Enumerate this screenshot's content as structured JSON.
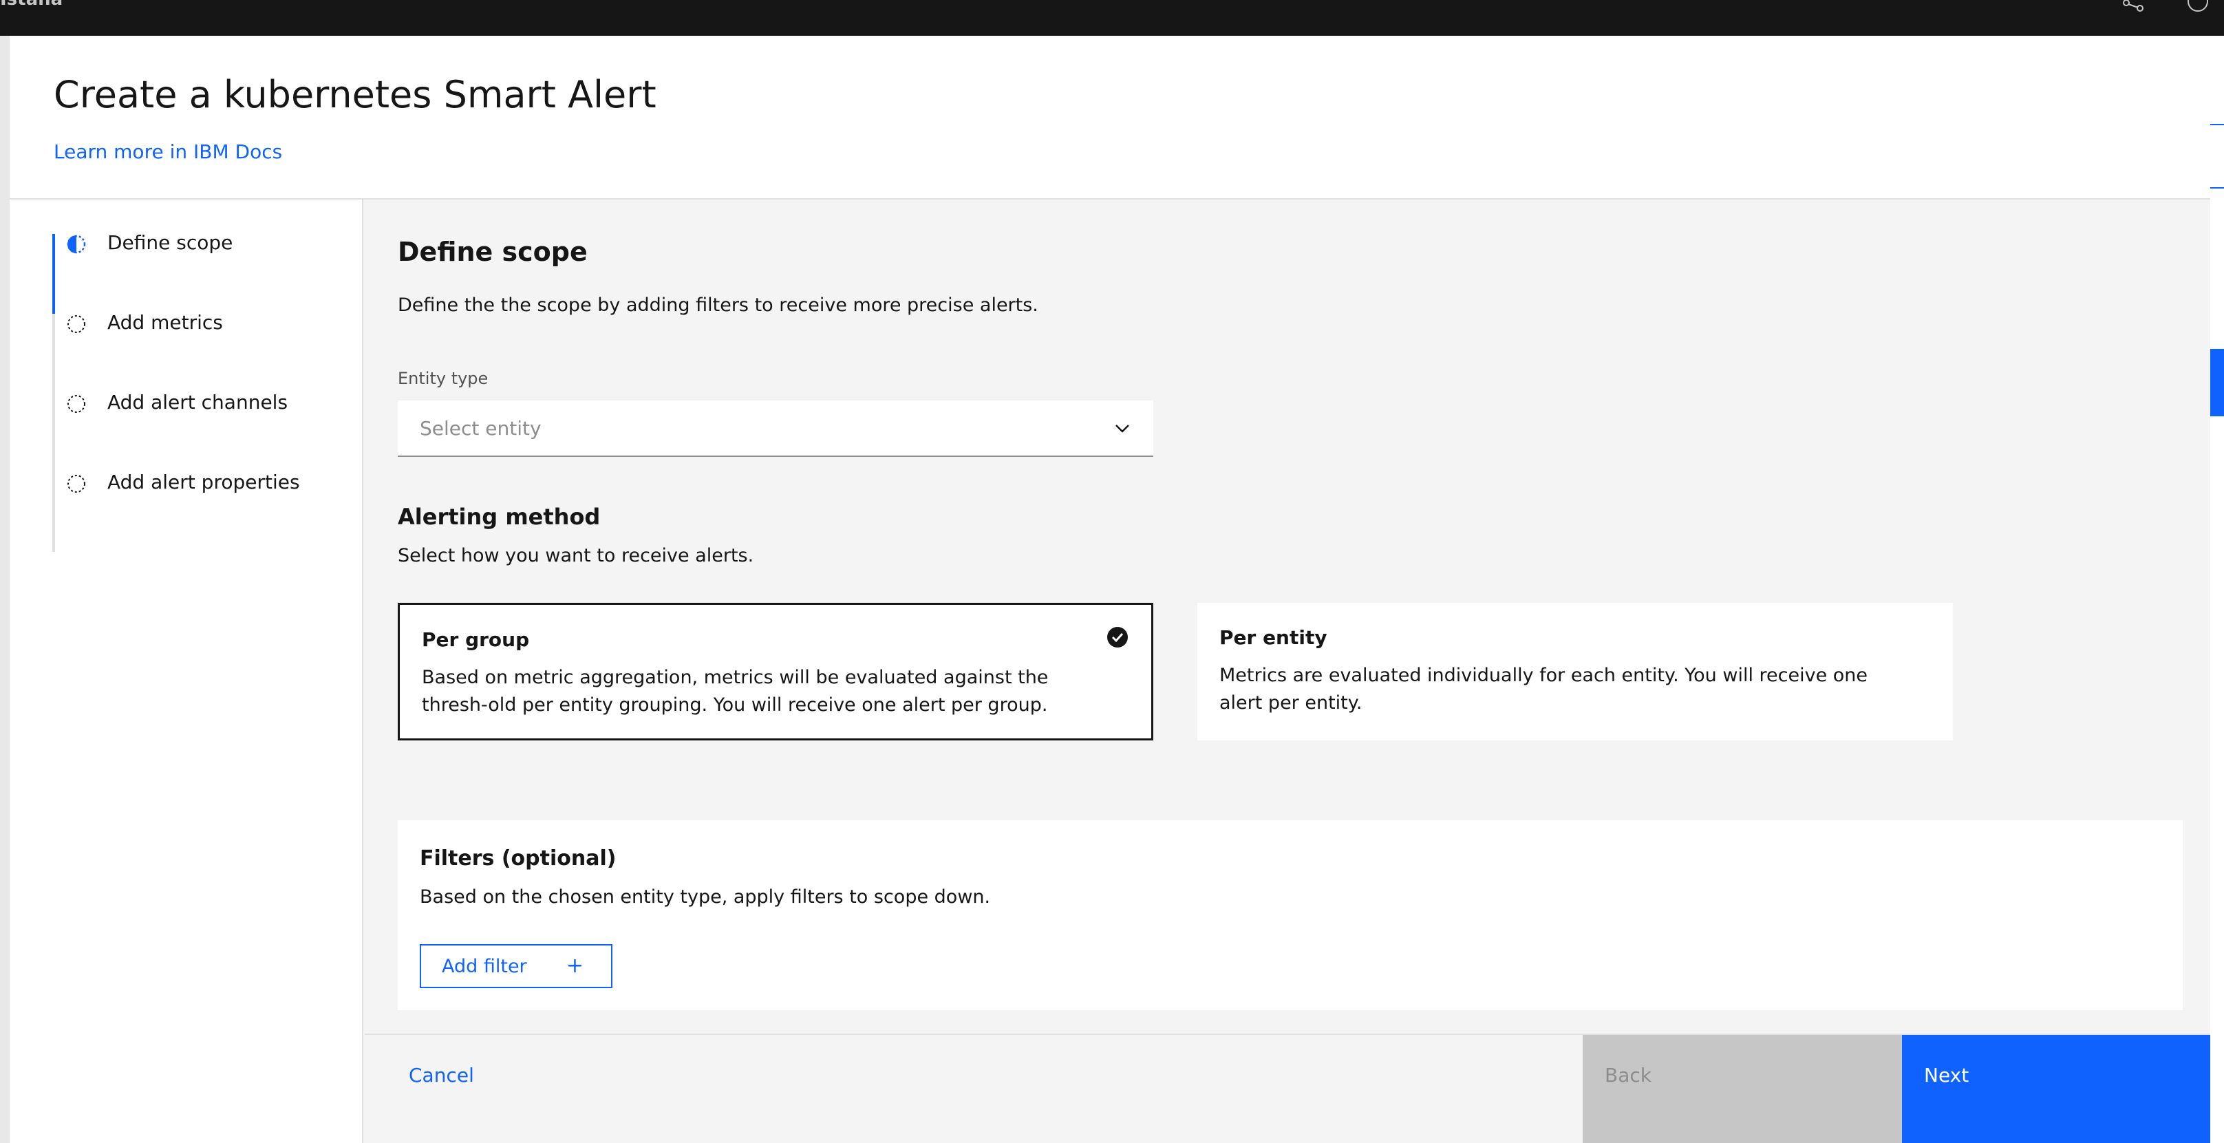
{
  "app": {
    "brand": "Istana"
  },
  "modal": {
    "title": "Create a kubernetes Smart Alert",
    "docs_link": "Learn more in IBM Docs"
  },
  "stepper": {
    "steps": [
      {
        "label": "Define scope",
        "state": "current"
      },
      {
        "label": "Add metrics",
        "state": "incomplete"
      },
      {
        "label": "Add alert channels",
        "state": "incomplete"
      },
      {
        "label": "Add alert properties",
        "state": "incomplete"
      }
    ]
  },
  "scope": {
    "heading": "Define scope",
    "description": "Define the the scope by adding filters to receive more precise alerts.",
    "entity_type": {
      "label": "Entity type",
      "placeholder": "Select entity"
    }
  },
  "alerting": {
    "heading": "Alerting method",
    "description": "Select how you want to receive alerts.",
    "options": [
      {
        "title": "Per group",
        "description": "Based on metric aggregation, metrics will be evaluated against the thresh-old per entity grouping. You will receive one alert per group.",
        "selected": true
      },
      {
        "title": "Per entity",
        "description": "Metrics are evaluated individually for each entity. You will receive one alert per entity.",
        "selected": false
      }
    ]
  },
  "filters": {
    "heading": "Filters (optional)",
    "description": "Based on the chosen entity type, apply filters to scope down.",
    "add_label": "Add filter",
    "add_icon": "+"
  },
  "footer": {
    "cancel": "Cancel",
    "back": "Back",
    "next": "Next"
  },
  "colors": {
    "accent": "#0f62fe",
    "disabled": "#c6c6c6",
    "text": "#161616"
  }
}
